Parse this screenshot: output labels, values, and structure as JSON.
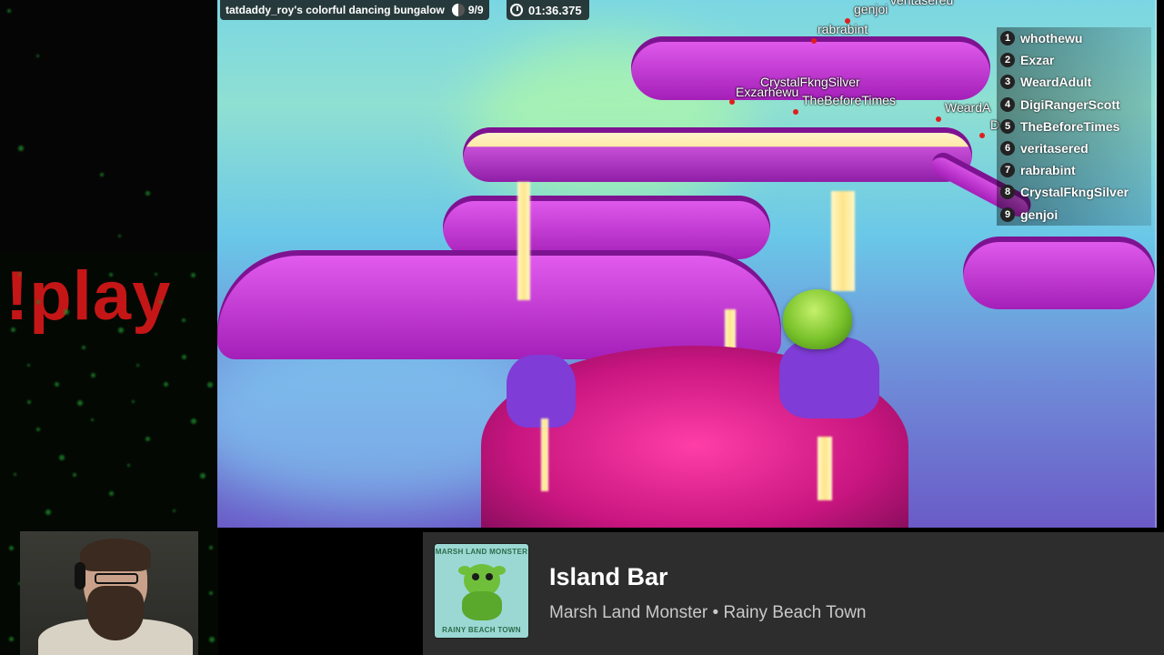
{
  "overlay": {
    "command": "!play"
  },
  "hud": {
    "race_title": "tatdaddy_roy's colorful dancing bungalow",
    "player_count": "9/9",
    "timer": "01:36.375"
  },
  "leaderboard": [
    {
      "rank": "1",
      "name": "whothewu"
    },
    {
      "rank": "2",
      "name": "Exzar"
    },
    {
      "rank": "3",
      "name": "WeardAdult"
    },
    {
      "rank": "4",
      "name": "DigiRangerScott"
    },
    {
      "rank": "5",
      "name": "TheBeforeTimes"
    },
    {
      "rank": "6",
      "name": "veritasered"
    },
    {
      "rank": "7",
      "name": "rabrabint"
    },
    {
      "rank": "8",
      "name": "CrystalFkngSilver"
    },
    {
      "rank": "9",
      "name": "genjoi"
    }
  ],
  "player_tags": {
    "genjoi": "genjoi",
    "veritasered": "veritasered",
    "rabrabint": "rabrabint",
    "crystal": "CrystalFkngSilver",
    "exzar": "Exzarhewu",
    "beforetimes": "TheBeforeTimes",
    "weard": "WeardA",
    "digi": "D"
  },
  "now_playing": {
    "title": "Island Bar",
    "subtitle": "Marsh Land Monster • Rainy Beach Town",
    "cover_top": "MARSH LAND MONSTER",
    "cover_bottom": "RAINY BEACH TOWN"
  },
  "colors": {
    "command_red": "#c41616",
    "panel_bg": "#2d2d2d",
    "track_magenta": "#e45ef0"
  }
}
